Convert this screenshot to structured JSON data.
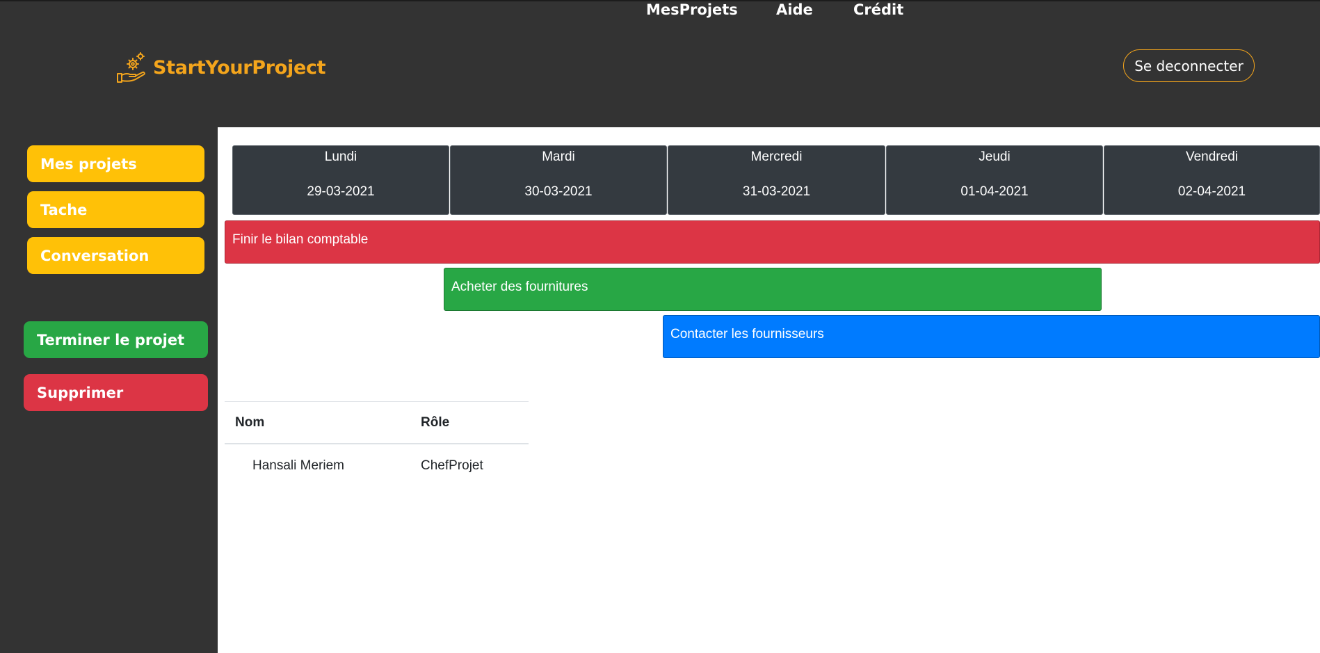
{
  "app": {
    "name": "StartYourProject",
    "brand_color": "#f4a51c",
    "logo_icon": "hand-gears-icon"
  },
  "nav": {
    "items": [
      {
        "label": "MesProjets"
      },
      {
        "label": "Aide"
      },
      {
        "label": "Crédit"
      }
    ],
    "logout_label": "Se deconnecter"
  },
  "sidebar": {
    "items": [
      {
        "label": "Mes projets",
        "color": "#ffc107"
      },
      {
        "label": "Tache",
        "color": "#ffc107"
      },
      {
        "label": "Conversation",
        "color": "#ffc107"
      }
    ],
    "actions": [
      {
        "label": "Terminer le projet",
        "color": "#28a745"
      },
      {
        "label": "Supprimer",
        "color": "#dc3545"
      }
    ]
  },
  "calendar": {
    "days": [
      {
        "name": "Lundi",
        "date": "29-03-2021"
      },
      {
        "name": "Mardi",
        "date": "30-03-2021"
      },
      {
        "name": "Mercredi",
        "date": "31-03-2021"
      },
      {
        "name": "Jeudi",
        "date": "01-04-2021"
      },
      {
        "name": "Vendredi",
        "date": "02-04-2021"
      }
    ],
    "tasks": [
      {
        "label": "Finir le bilan comptable",
        "color": "#dc3545"
      },
      {
        "label": "Acheter des fournitures",
        "color": "#28a745"
      },
      {
        "label": "Contacter les fournisseurs",
        "color": "#007bff"
      }
    ]
  },
  "members": {
    "headers": {
      "name": "Nom",
      "role": "Rôle"
    },
    "rows": [
      {
        "name": "Hansali Meriem",
        "role": "ChefProjet"
      }
    ]
  }
}
